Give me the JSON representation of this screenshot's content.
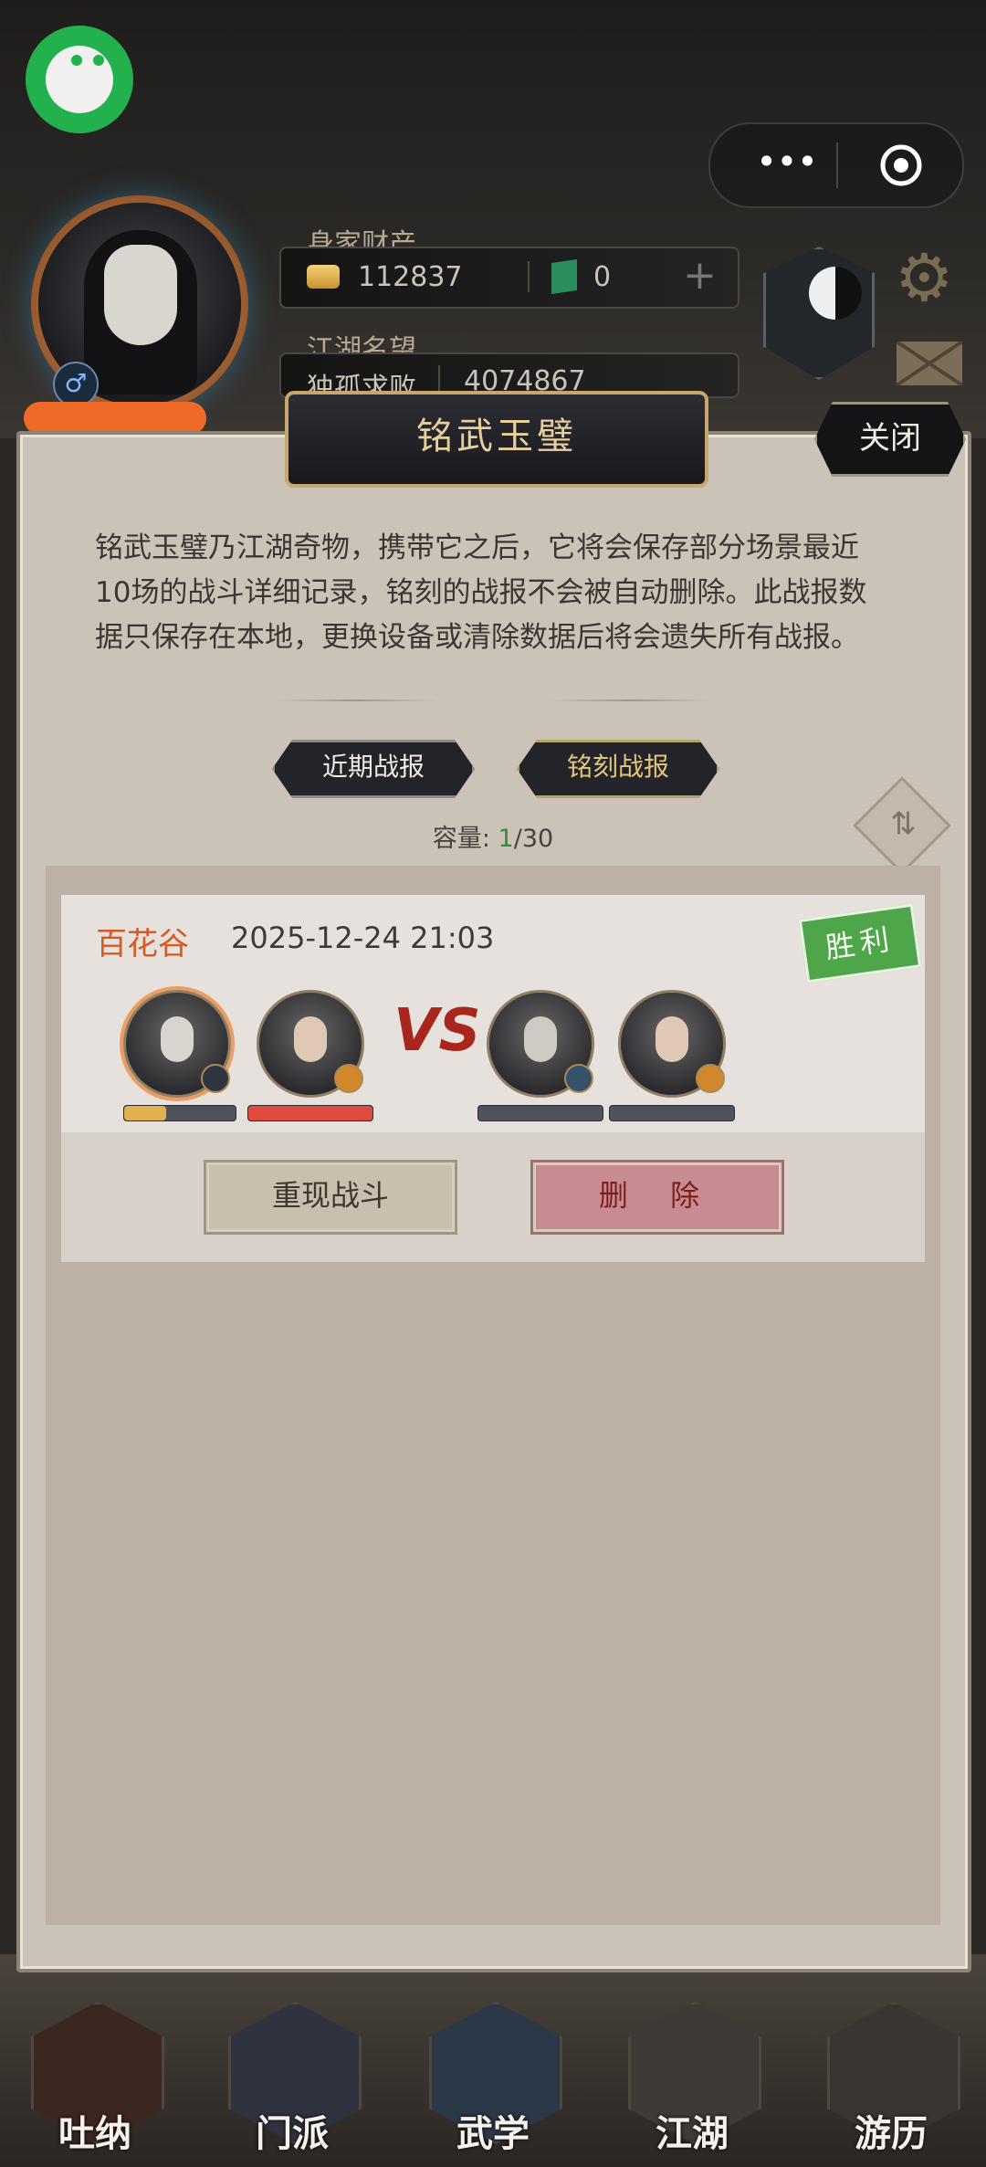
{
  "app": {
    "name": "铭武玉璧"
  },
  "header": {
    "wealth_label": "身家财产",
    "gold_amount": "112837",
    "jade_amount": "0",
    "reputation_label": "江湖名望",
    "rank_title": "独孤求败",
    "reputation_value": "4074867"
  },
  "mini_program": {
    "more": "•••"
  },
  "dialog": {
    "title": "铭武玉璧",
    "close_label": "关闭",
    "description": "铭武玉璧乃江湖奇物，携带它之后，它将会保存部分场景最近10场的战斗详细记录，铭刻的战报不会被自动删除。此战报数据只保存在本地，更换设备或清除数据后将会遗失所有战报。",
    "tabs": [
      {
        "label": "近期战报",
        "active": false
      },
      {
        "label": "铭刻战报",
        "active": true
      }
    ],
    "capacity_label": "容量:",
    "capacity_current": "1",
    "capacity_total": "/30"
  },
  "records": [
    {
      "location": "百花谷",
      "time": "2025-12-24 21:03",
      "result": "胜利",
      "vs": "VS",
      "team_a_hp": [
        0.38,
        1.0
      ],
      "replay_label": "重现战斗",
      "delete_label": "删 除"
    }
  ],
  "bottom_nav": [
    {
      "label": "吐纳",
      "icon": "gourd-icon"
    },
    {
      "label": "门派",
      "icon": "faction-icon"
    },
    {
      "label": "武学",
      "icon": "manual-icon"
    },
    {
      "label": "江湖",
      "icon": "hat-icon"
    },
    {
      "label": "游历",
      "icon": "horse-icon"
    }
  ],
  "colors": {
    "accent_gold": "#e7cf9b",
    "victory_green": "#4fa54a",
    "location_orange": "#d65a22",
    "delete_red": "#c88b91"
  }
}
